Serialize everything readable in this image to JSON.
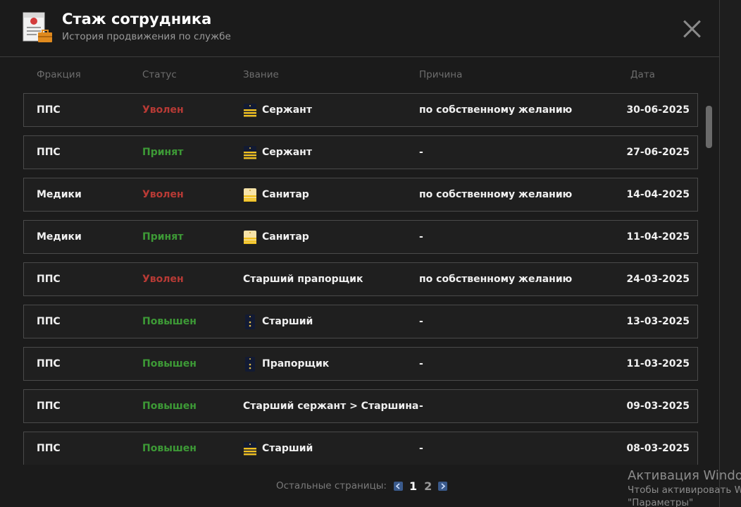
{
  "header": {
    "title": "Стаж сотрудника",
    "subtitle": "История продвижения по службе"
  },
  "columns": {
    "faction": "Фракция",
    "status": "Статус",
    "rank": "Звание",
    "reason": "Причина",
    "date": "Дата"
  },
  "rows": [
    {
      "faction": "ППС",
      "status": "Уволен",
      "status_type": "fired",
      "rank": "Сержант",
      "rank_icon": "sergeant-shoulder-strap-icon",
      "reason": "по собственному желанию",
      "date": "30-06-2025"
    },
    {
      "faction": "ППС",
      "status": "Принят",
      "status_type": "hired",
      "rank": "Сержант",
      "rank_icon": "sergeant-shoulder-strap-icon",
      "reason": "-",
      "date": "27-06-2025"
    },
    {
      "faction": "Медики",
      "status": "Уволен",
      "status_type": "fired",
      "rank": "Санитар",
      "rank_icon": "medic-shoulder-strap-icon",
      "reason": "по собственному желанию",
      "date": "14-04-2025"
    },
    {
      "faction": "Медики",
      "status": "Принят",
      "status_type": "hired",
      "rank": "Санитар",
      "rank_icon": "medic-shoulder-strap-icon",
      "reason": "-",
      "date": "11-04-2025"
    },
    {
      "faction": "ППС",
      "status": "Уволен",
      "status_type": "fired",
      "rank": "Старший прапорщик",
      "rank_icon": "",
      "reason": "по собственному желанию",
      "date": "24-03-2025"
    },
    {
      "faction": "ППС",
      "status": "Повышен",
      "status_type": "promoted",
      "rank": "Старший",
      "rank_icon": "warrant-officer-shoulder-strap-icon",
      "reason": "-",
      "date": "13-03-2025"
    },
    {
      "faction": "ППС",
      "status": "Повышен",
      "status_type": "promoted",
      "rank": "Прапорщик",
      "rank_icon": "warrant-officer-shoulder-strap-icon",
      "reason": "-",
      "date": "11-03-2025"
    },
    {
      "faction": "ППС",
      "status": "Повышен",
      "status_type": "promoted",
      "rank": "Старший сержант > Старшина",
      "rank_icon": "",
      "reason": "-",
      "date": "09-03-2025"
    },
    {
      "faction": "ППС",
      "status": "Повышен",
      "status_type": "promoted",
      "rank": "Старший",
      "rank_icon": "sergeant-shoulder-strap-icon",
      "reason": "-",
      "date": "08-03-2025"
    }
  ],
  "pagination": {
    "label": "Остальные страницы:",
    "pages": [
      "1",
      "2"
    ],
    "current": "1"
  },
  "watermark": {
    "title": "Активация Windows",
    "line1": "Чтобы активировать Windows,",
    "line2": "\"Параметры\""
  },
  "colors": {
    "fired": "#b73a35",
    "hired": "#3d9a36",
    "promoted": "#3d9a36",
    "pager_arrow": "#3a5a8c"
  }
}
